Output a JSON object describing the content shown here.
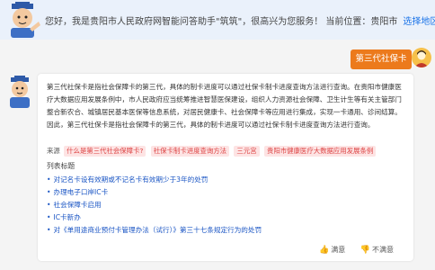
{
  "banner": {
    "greeting": "您好，我是贵阳市人民政府网智能问答助手\"筑筑\"，很高兴为您服务！ 当前位置：贵阳市",
    "select_region": "选择地区"
  },
  "user_message": "第三代社保卡",
  "answer": {
    "text": "第三代社保卡是指社会保障卡的第三代，具体的制卡进度可以通过社保卡制卡进度查询方法进行查询。在贵阳市健康医疗大数据应用发展条例中，市人民政府应当统筹推进智慧医保建设，组织人力资源社会保障、卫生计生等有关主管部门整合新农合、城镇居民基本医保等信息系统，对居民健康卡、社会保障卡等应用进行集成，实现一卡通用、诊间结算。因此，第三代社保卡是指社会保障卡的第三代，具体的制卡进度可以通过社保卡制卡进度查询方法进行查询。",
    "source_label": "来源",
    "sources": [
      "什么是第三代社会保障卡?",
      "社保卡制卡进度查询方法",
      "三元宫",
      "贵阳市健康医疗大数据应用发展条例"
    ],
    "list_title": "列表标题",
    "list_items": [
      "对记名卡设有效期或不记名卡有效期少于3年的处罚",
      "办理电子口岸IC卡",
      "社会保障卡启用",
      "IC卡新办",
      "对《单用途商业预付卡管理办法（试行）》第三十七条规定行为的处罚"
    ],
    "satisfied": "满意",
    "unsatisfied": "不满意"
  }
}
